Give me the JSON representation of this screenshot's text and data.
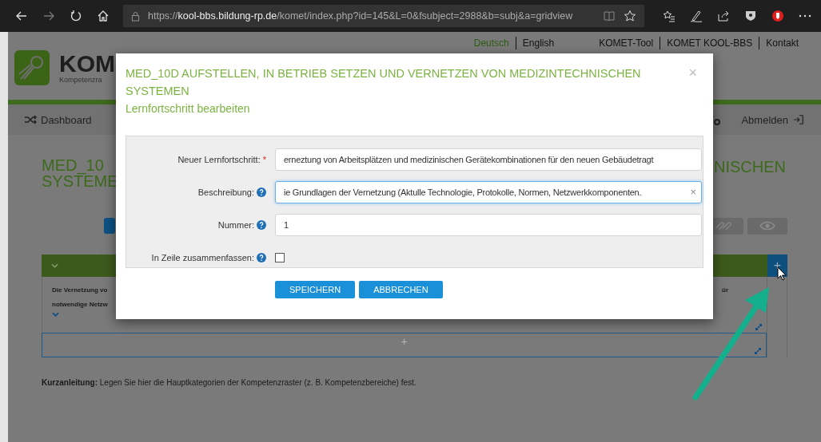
{
  "browser": {
    "url": {
      "scheme": "https://",
      "host": "kool-bbs.bildung-rp.de",
      "path": "/komet/index.php?id=145&L=0&fsubject=2988&b=subj&a=gridview"
    }
  },
  "site": {
    "logo": {
      "text": "KOM",
      "subtitle": "Kompetenzra"
    },
    "languages": [
      {
        "label": "Deutsch",
        "selected": true
      },
      {
        "label": "English",
        "selected": false
      }
    ],
    "top_links": [
      "KOMET-Tool",
      "KOMET KOOL-BBS",
      "Kontakt"
    ],
    "nav": {
      "dashboard": "Dashboard",
      "logout": "Abmelden"
    },
    "title_left": [
      "MED_10",
      "SYSTEME"
    ],
    "title_right": "NISCHEN",
    "grid": {
      "cell_lines": [
        "Die Vernetzung vo",
        "notwendige Netzw"
      ],
      "cell_right": "ür",
      "add_sign": "+",
      "row_add_sign": "+"
    },
    "hint": "**Kurzanleitung:** Legen Sie hier die Hauptkategorien der Kompetenzraster (z. B. Kompetenzbereiche) fest."
  },
  "modal": {
    "title": "MED_10D AUFSTELLEN, IN BETRIEB SETZEN UND VERNETZEN VON MEDIZINTECHNISCHEN SYSTEMEN",
    "subtitle": "Lernfortschritt bearbeiten",
    "close": "×",
    "fields": [
      {
        "kind": "text",
        "label": "Neuer Lernfortschritt:",
        "required_mark": "*",
        "focused": false,
        "value": "erneztung von Arbeitsplätzen und medizinischen Gerätekombinationen für den neuen Gebäudetragt"
      },
      {
        "kind": "text",
        "label": "Beschreibung:",
        "help": true,
        "focused": true,
        "clear": "×",
        "value": "ie Grundlagen der Vernetzung (Aktulle Technologie, Protokolle, Normen, Netzwerkkomponenten."
      },
      {
        "kind": "text",
        "label": "Nummer:",
        "help": true,
        "focused": false,
        "value": "1"
      },
      {
        "kind": "checkbox",
        "label": "In Zeile zusammenfassen:",
        "help": true,
        "checked": false
      }
    ],
    "buttons": [
      "SPEICHERN",
      "ABBRECHEN"
    ]
  }
}
